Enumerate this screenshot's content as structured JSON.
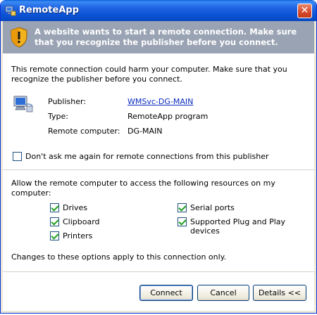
{
  "window": {
    "title": "RemoteApp",
    "close_glyph": "✕"
  },
  "banner": {
    "text": "A website wants to start a remote connection. Make sure that you recognize the publisher before you connect.",
    "icon": "shield-warning-icon"
  },
  "warning": "This remote connection could harm your computer. Make sure that you recognize the publisher before you connect.",
  "details": {
    "publisher_label": "Publisher:",
    "publisher_value": "WMSvc-DG-MAIN",
    "type_label": "Type:",
    "type_value": "RemoteApp program",
    "remote_label": "Remote computer:",
    "remote_value": "DG-MAIN"
  },
  "dont_ask": {
    "label": "Don't ask me again for remote connections from this publisher",
    "checked": false
  },
  "resources": {
    "heading": "Allow the remote computer to access the following resources on my computer:",
    "drives": {
      "label": "Drives",
      "checked": true
    },
    "clipboard": {
      "label": "Clipboard",
      "checked": true
    },
    "printers": {
      "label": "Printers",
      "checked": true
    },
    "serial": {
      "label": "Serial ports",
      "checked": true
    },
    "pnp": {
      "label": "Supported Plug and Play devices",
      "checked": true
    }
  },
  "note": "Changes to these options apply to this connection only.",
  "buttons": {
    "connect": "Connect",
    "cancel": "Cancel",
    "details": "Details <<"
  },
  "colors": {
    "titlebar": "#0a53d6",
    "banner": "#9aa3b3",
    "link": "#0b2bbd",
    "check": "#21a121"
  }
}
